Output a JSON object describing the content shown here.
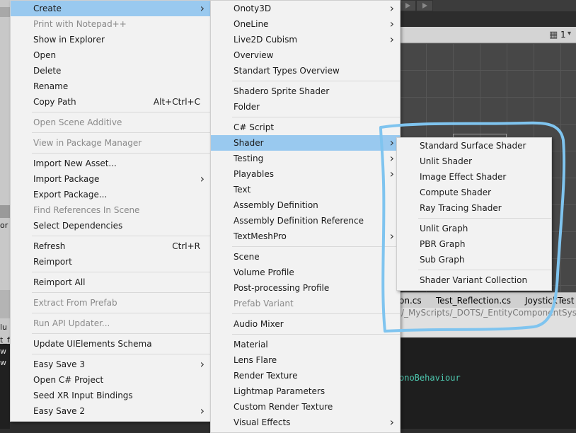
{
  "background": {
    "left_labels": [
      "or",
      "lu",
      "t_f",
      "w",
      "w"
    ],
    "scene_toolbar": {
      "grid_count": "1"
    },
    "tabs": [
      "on.cs",
      "Test_Reflection.cs",
      "JoystickTest"
    ],
    "path": "/_MyScripts/_DOTS/_EntityComponentSystem",
    "code_line": "onoBehaviour"
  },
  "menu_main": [
    {
      "type": "item",
      "label": "Create",
      "arrow": true,
      "highlight": true
    },
    {
      "type": "item",
      "label": "Print with Notepad++",
      "disabled": true
    },
    {
      "type": "item",
      "label": "Show in Explorer"
    },
    {
      "type": "item",
      "label": "Open"
    },
    {
      "type": "item",
      "label": "Delete"
    },
    {
      "type": "item",
      "label": "Rename"
    },
    {
      "type": "item",
      "label": "Copy Path",
      "shortcut": "Alt+Ctrl+C"
    },
    {
      "type": "sep"
    },
    {
      "type": "item",
      "label": "Open Scene Additive",
      "disabled": true
    },
    {
      "type": "sep"
    },
    {
      "type": "item",
      "label": "View in Package Manager",
      "disabled": true
    },
    {
      "type": "sep"
    },
    {
      "type": "item",
      "label": "Import New Asset..."
    },
    {
      "type": "item",
      "label": "Import Package",
      "arrow": true
    },
    {
      "type": "item",
      "label": "Export Package..."
    },
    {
      "type": "item",
      "label": "Find References In Scene",
      "disabled": true
    },
    {
      "type": "item",
      "label": "Select Dependencies"
    },
    {
      "type": "sep"
    },
    {
      "type": "item",
      "label": "Refresh",
      "shortcut": "Ctrl+R"
    },
    {
      "type": "item",
      "label": "Reimport"
    },
    {
      "type": "sep"
    },
    {
      "type": "item",
      "label": "Reimport All"
    },
    {
      "type": "sep"
    },
    {
      "type": "item",
      "label": "Extract From Prefab",
      "disabled": true
    },
    {
      "type": "sep"
    },
    {
      "type": "item",
      "label": "Run API Updater...",
      "disabled": true
    },
    {
      "type": "sep"
    },
    {
      "type": "item",
      "label": "Update UIElements Schema"
    },
    {
      "type": "sep"
    },
    {
      "type": "item",
      "label": "Easy Save 3",
      "arrow": true
    },
    {
      "type": "item",
      "label": "Open C# Project"
    },
    {
      "type": "item",
      "label": "Seed XR Input Bindings"
    },
    {
      "type": "item",
      "label": "Easy Save 2",
      "arrow": true
    }
  ],
  "menu_create": [
    {
      "type": "item",
      "label": "Onoty3D",
      "arrow": true
    },
    {
      "type": "item",
      "label": "OneLine",
      "arrow": true
    },
    {
      "type": "item",
      "label": "Live2D Cubism",
      "arrow": true
    },
    {
      "type": "item",
      "label": "Overview"
    },
    {
      "type": "item",
      "label": "Standart Types Overview"
    },
    {
      "type": "sep"
    },
    {
      "type": "item",
      "label": "Shadero Sprite Shader"
    },
    {
      "type": "item",
      "label": "Folder"
    },
    {
      "type": "sep"
    },
    {
      "type": "item",
      "label": "C# Script"
    },
    {
      "type": "item",
      "label": "Shader",
      "arrow": true,
      "highlight": true
    },
    {
      "type": "item",
      "label": "Testing",
      "arrow": true
    },
    {
      "type": "item",
      "label": "Playables",
      "arrow": true
    },
    {
      "type": "item",
      "label": "Text"
    },
    {
      "type": "item",
      "label": "Assembly Definition"
    },
    {
      "type": "item",
      "label": "Assembly Definition Reference"
    },
    {
      "type": "item",
      "label": "TextMeshPro",
      "arrow": true
    },
    {
      "type": "sep"
    },
    {
      "type": "item",
      "label": "Scene"
    },
    {
      "type": "item",
      "label": "Volume Profile"
    },
    {
      "type": "item",
      "label": "Post-processing Profile"
    },
    {
      "type": "item",
      "label": "Prefab Variant",
      "disabled": true
    },
    {
      "type": "sep"
    },
    {
      "type": "item",
      "label": "Audio Mixer"
    },
    {
      "type": "sep"
    },
    {
      "type": "item",
      "label": "Material"
    },
    {
      "type": "item",
      "label": "Lens Flare"
    },
    {
      "type": "item",
      "label": "Render Texture"
    },
    {
      "type": "item",
      "label": "Lightmap Parameters"
    },
    {
      "type": "item",
      "label": "Custom Render Texture"
    },
    {
      "type": "item",
      "label": "Visual Effects",
      "arrow": true
    }
  ],
  "menu_shader": [
    {
      "type": "item",
      "label": "Standard Surface Shader"
    },
    {
      "type": "item",
      "label": "Unlit Shader"
    },
    {
      "type": "item",
      "label": "Image Effect Shader"
    },
    {
      "type": "item",
      "label": "Compute Shader"
    },
    {
      "type": "item",
      "label": "Ray Tracing Shader"
    },
    {
      "type": "sep"
    },
    {
      "type": "item",
      "label": "Unlit Graph"
    },
    {
      "type": "item",
      "label": "PBR Graph"
    },
    {
      "type": "item",
      "label": "Sub Graph"
    },
    {
      "type": "sep"
    },
    {
      "type": "item",
      "label": "Shader Variant Collection"
    }
  ],
  "colors": {
    "highlight": "#99c9ef",
    "annotation": "#7fc4ef",
    "menu_bg": "#f2f2f2"
  }
}
